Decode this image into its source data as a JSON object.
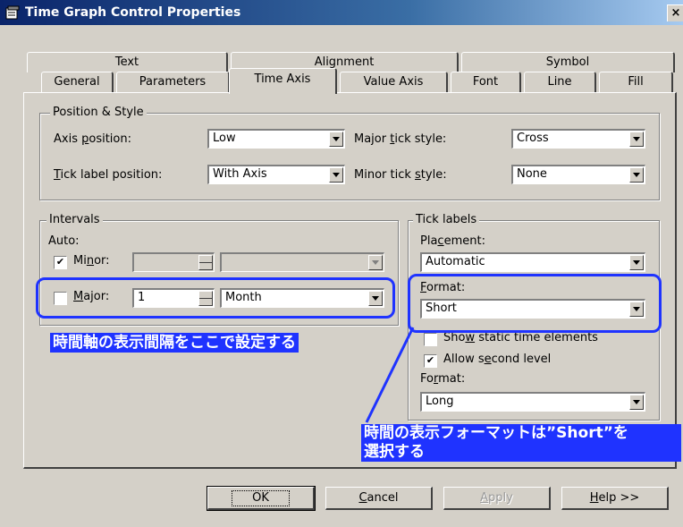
{
  "window": {
    "title": "Time Graph Control Properties",
    "close": "×"
  },
  "tabs": {
    "row1": [
      "Text",
      "Alignment",
      "Symbol"
    ],
    "row2": [
      "General",
      "Parameters",
      "Time Axis",
      "Value Axis",
      "Font",
      "Line",
      "Fill"
    ],
    "active": "Time Axis"
  },
  "position_style": {
    "legend": "Position & Style",
    "axis_position_label": "Axis position:",
    "axis_position_value": "Low",
    "tick_label_position_label": "Tick label position:",
    "tick_label_position_value": "With Axis",
    "major_tick_style_label": "Major tick style:",
    "major_tick_style_value": "Cross",
    "minor_tick_style_label": "Minor tick style:",
    "minor_tick_style_value": "None"
  },
  "intervals": {
    "legend": "Intervals",
    "auto_label": "Auto:",
    "minor_label": "Minor:",
    "minor_checked": true,
    "minor_value": "",
    "minor_unit": "",
    "major_label": "Major:",
    "major_checked": false,
    "major_value": "1",
    "major_unit": "Month"
  },
  "tick_labels": {
    "legend": "Tick labels",
    "placement_label": "Placement:",
    "placement_value": "Automatic",
    "format_label": "Format:",
    "format_value": "Short",
    "show_static_label": "Show static time elements",
    "show_static_checked": false,
    "allow_second_label": "Allow second level",
    "allow_second_checked": true,
    "format2_label": "Format:",
    "format2_value": "Long"
  },
  "buttons": {
    "ok": "OK",
    "cancel": "Cancel",
    "apply": "Apply",
    "help": "Help >>"
  },
  "annotations": {
    "intervals_note": "時間軸の表示間隔をここで設定する",
    "format_note_line1": "時間の表示フォーマットは”Short”を",
    "format_note_line2": "選択する"
  },
  "colors": {
    "annotation_blue": "#1f33ff",
    "dialog_bg": "#d4d0c8",
    "titlebar": "#0a246a"
  },
  "icons": {
    "window": "properties-icon",
    "check": "✔"
  }
}
